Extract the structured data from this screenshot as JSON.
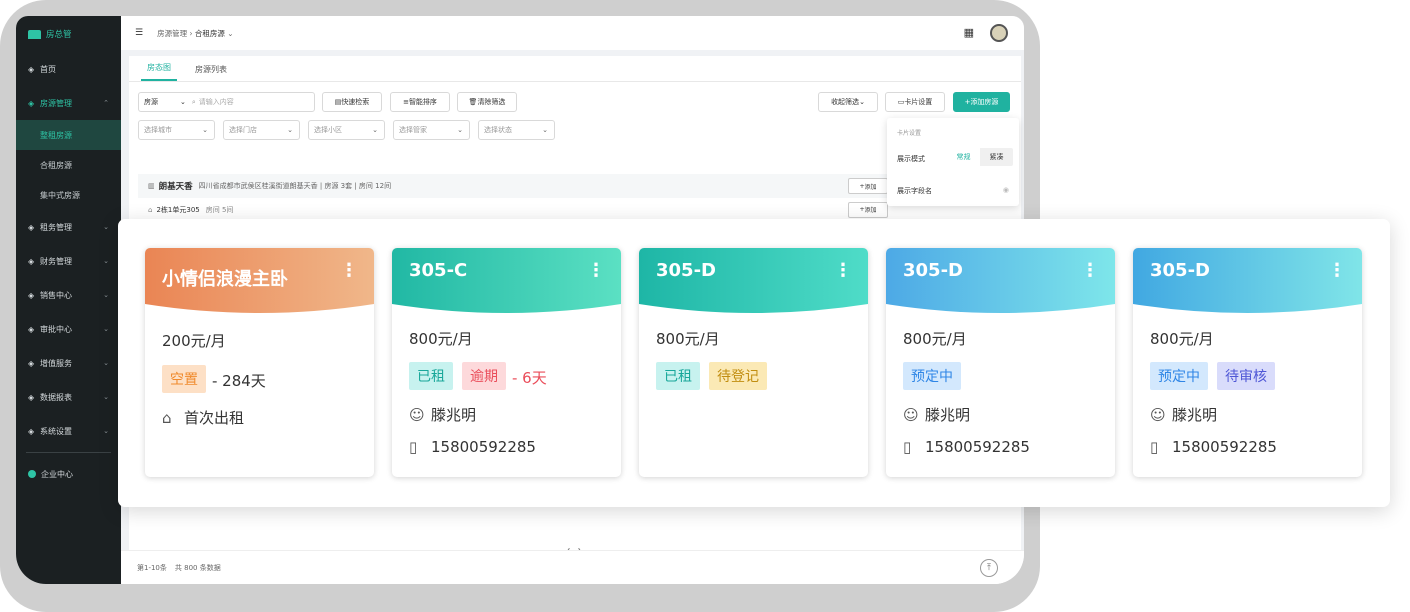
{
  "app": {
    "brand": "房总管"
  },
  "sidebar": {
    "items": [
      {
        "label": "首页",
        "icon": "home-icon"
      },
      {
        "label": "房源管理",
        "icon": "building-icon",
        "expanded": true
      },
      {
        "label": "整租房源",
        "sub": true,
        "active": true
      },
      {
        "label": "合租房源",
        "sub": true
      },
      {
        "label": "集中式房源",
        "sub": true
      },
      {
        "label": "租务管理",
        "icon": "lease-icon"
      },
      {
        "label": "财务管理",
        "icon": "finance-icon"
      },
      {
        "label": "销售中心",
        "icon": "sales-icon"
      },
      {
        "label": "审批中心",
        "icon": "approval-icon"
      },
      {
        "label": "增值服务",
        "icon": "service-icon"
      },
      {
        "label": "数据报表",
        "icon": "report-icon"
      },
      {
        "label": "系统设置",
        "icon": "settings-icon"
      }
    ],
    "enterprise": "企业中心"
  },
  "topbar": {
    "breadcrumb_parent": "房源管理",
    "breadcrumb_current": "合租房源"
  },
  "tabs": [
    {
      "label": "房态图",
      "active": true
    },
    {
      "label": "房源列表"
    }
  ],
  "filters": {
    "type_select": "房源",
    "search_placeholder": "请输入内容",
    "quick_search": "快速检索",
    "smart_sort": "智能排序",
    "clear_filter": "清除筛选",
    "collapse": "收起筛选",
    "card_settings": "卡片设置",
    "add_house": "添加房源",
    "selects": [
      "选择城市",
      "选择门店",
      "选择小区",
      "选择管家",
      "选择状态"
    ]
  },
  "settings_popup": {
    "title": "卡片设置",
    "mode_label": "展示模式",
    "mode_options": [
      "常规",
      "紧凑"
    ],
    "field_label": "展示字段名"
  },
  "house": {
    "name": "朗基天香",
    "address": "四川省成都市武侯区桂溪街道朗基天香 | 房源 3套 | 房间 12间",
    "add_label": "添加",
    "room": {
      "name": "2栋1单元305",
      "meta": "房间 5间"
    }
  },
  "footer": {
    "range": "第1-10条",
    "total": "共 800 条数据"
  },
  "colors": {
    "accent": "#20b2a0",
    "sidebar_bg": "#1b2022"
  },
  "cards": [
    {
      "title": "小情侣浪漫主卧",
      "price": "200元/月",
      "tags": [
        {
          "text": "空置",
          "kind": "orange"
        }
      ],
      "trail": "- 284天",
      "trail_color": "#333333",
      "line1": "首次出租",
      "line1_icon": "home-outline-icon",
      "gradient": [
        "#ea8554",
        "#f0b78a"
      ],
      "title_size": "18px"
    },
    {
      "title": "305-C",
      "price": "800元/月",
      "tags": [
        {
          "text": "已租",
          "kind": "cyan"
        },
        {
          "text": "逾期",
          "kind": "red"
        }
      ],
      "trail": "- 6天",
      "trail_color": "#ea4d5a",
      "person": "滕兆明",
      "phone": "15800592285",
      "gradient": [
        "#21b8a4",
        "#5be0c3"
      ]
    },
    {
      "title": "305-D",
      "price": "800元/月",
      "tags": [
        {
          "text": "已租",
          "kind": "cyan"
        },
        {
          "text": "待登记",
          "kind": "yellow"
        }
      ],
      "gradient": [
        "#1eb6a6",
        "#4fdcc8"
      ]
    },
    {
      "title": "305-D",
      "price": "800元/月",
      "tags": [
        {
          "text": "预定中",
          "kind": "blue"
        }
      ],
      "person": "滕兆明",
      "phone": "15800592285",
      "gradient": [
        "#4da9e6",
        "#7ee6ea"
      ]
    },
    {
      "title": "305-D",
      "price": "800元/月",
      "tags": [
        {
          "text": "预定中",
          "kind": "blue"
        },
        {
          "text": "待审核",
          "kind": "purple"
        }
      ],
      "person": "滕兆明",
      "phone": "15800592285",
      "gradient": [
        "#41a8e2",
        "#80e5e8"
      ]
    }
  ]
}
